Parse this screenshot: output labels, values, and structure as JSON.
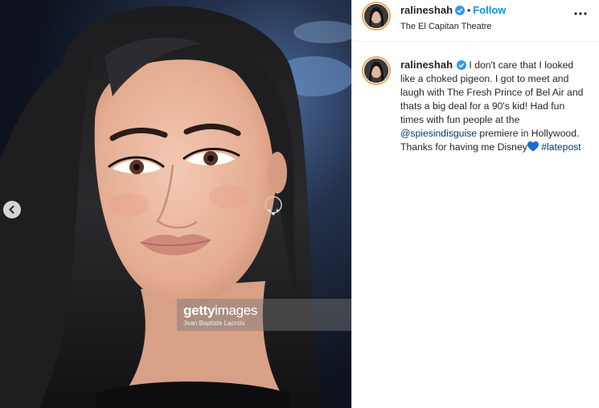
{
  "post": {
    "username": "ralineshah",
    "follow_label": "Follow",
    "separator": "•",
    "location": "The El Capitan Theatre",
    "caption_text_1": "I don't care that I looked like a choked pigeon. I got to meet and laugh with The Fresh Prince of Bel Air and thats a big deal for a 90's kid! Had fun times with fun people at the ",
    "caption_mention": "@spiesindisguise",
    "caption_text_2": " premiere in Hollywood. Thanks for having me Disney",
    "caption_hashtag": "#latepost"
  },
  "photo": {
    "watermark_logo_bold": "getty",
    "watermark_logo_light": "images",
    "watermark_credit": "Jean Baptiste Lacroix"
  },
  "icons": {
    "verified": "verified-badge-icon",
    "more": "more-options-icon",
    "prev": "chevron-left-icon",
    "heart": "blue-heart-emoji"
  },
  "colors": {
    "follow": "#0095f6",
    "verified": "#3897f0",
    "link": "#00376b",
    "heart": "#1b6fd0",
    "story_ring": "#e6ad5a"
  }
}
